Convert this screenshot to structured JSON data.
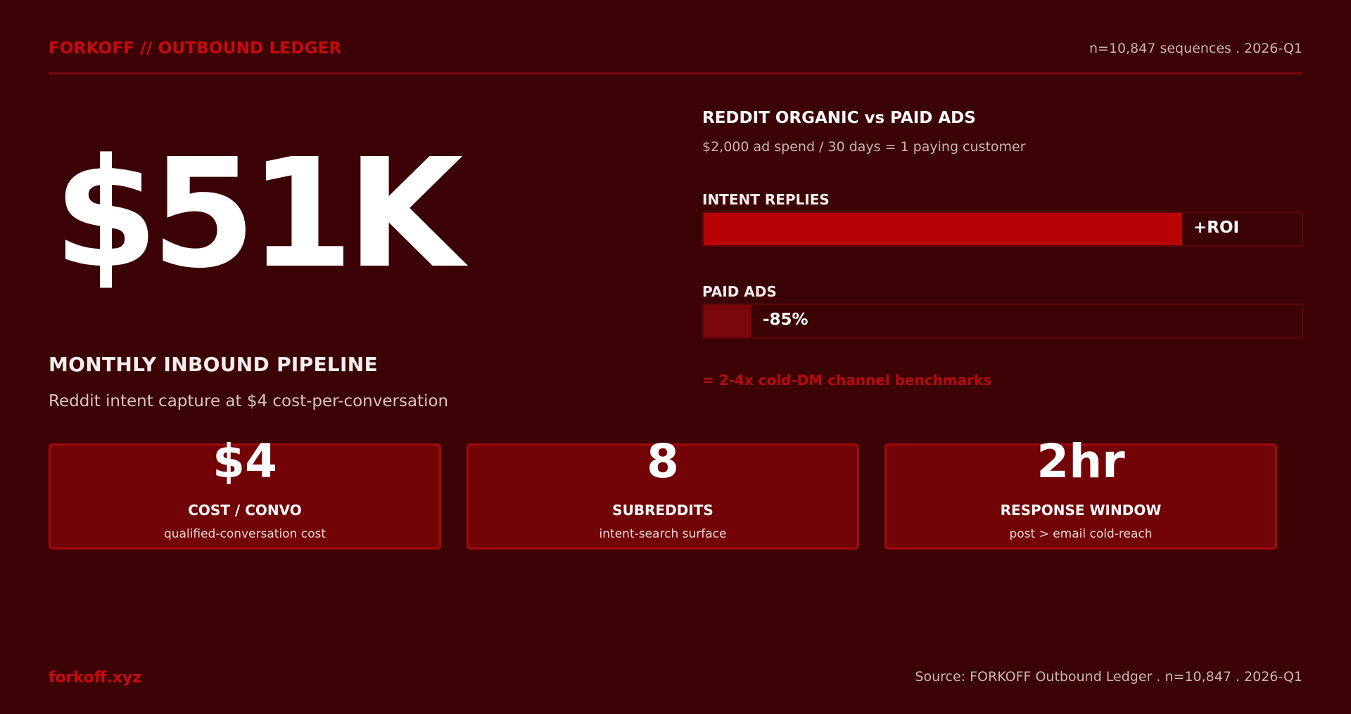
{
  "header": {
    "brand": "FORKOFF // OUTBOUND LEDGER",
    "meta": "n=10,847 sequences . 2026-Q1"
  },
  "hero": {
    "value": "$51K",
    "title": "MONTHLY INBOUND PIPELINE",
    "subtitle": "Reddit intent capture at $4 cost-per-conversation"
  },
  "comparison": {
    "title": "REDDIT ORGANIC vs PAID ADS",
    "subtitle": "$2,000 ad spend / 30 days = 1 paying customer",
    "bars": [
      {
        "label": "INTENT REPLIES",
        "value": "+ROI",
        "fill_fraction": 0.8,
        "color": "#b80206"
      },
      {
        "label": "PAID ADS",
        "value": "-85%",
        "fill_fraction": 0.08,
        "color": "#7a0709"
      }
    ],
    "benchmark": "= 2-4x cold-DM channel benchmarks"
  },
  "cards": [
    {
      "number": "$4",
      "label": "COST / CONVO",
      "desc": "qualified-conversation cost"
    },
    {
      "number": "8",
      "label": "SUBREDDITS",
      "desc": "intent-search surface"
    },
    {
      "number": "2hr",
      "label": "RESPONSE WINDOW",
      "desc": "post > email cold-reach"
    }
  ],
  "footer": {
    "brand": "forkoff.xyz",
    "source": "Source: FORKOFF Outbound Ledger . n=10,847 . 2026-Q1"
  },
  "colors": {
    "background": "#3c0306",
    "accent": "#c80a0e",
    "card": "#720306"
  }
}
